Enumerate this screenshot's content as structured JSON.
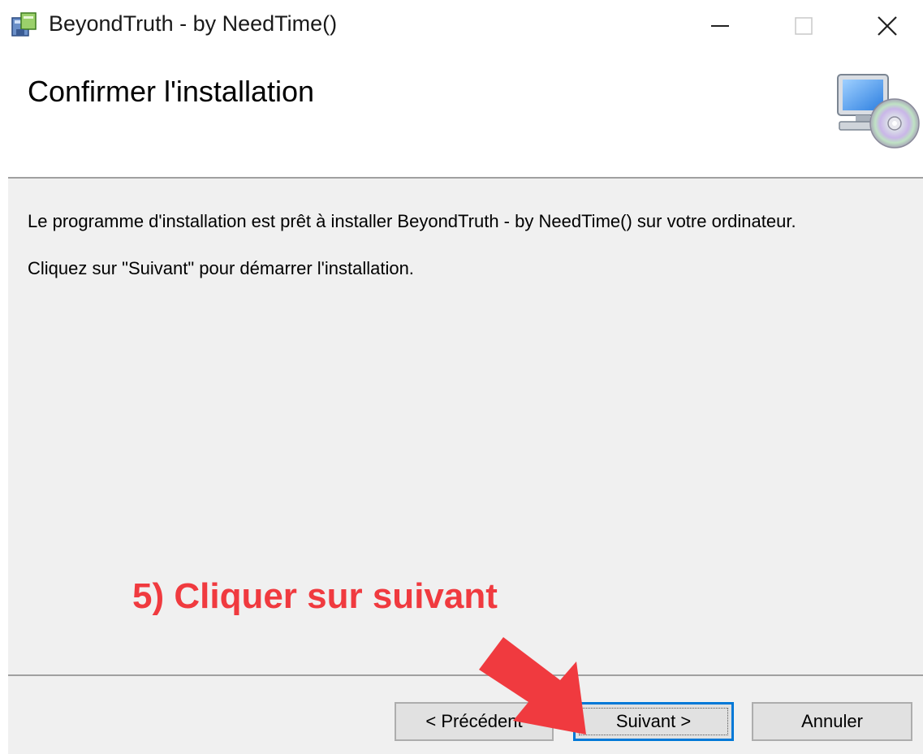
{
  "window": {
    "title": "BeyondTruth - by NeedTime()",
    "app_icon": "installer-icon",
    "controls": {
      "minimize": "minimize-icon",
      "maximize": "maximize-icon",
      "close": "close-icon"
    }
  },
  "header": {
    "title": "Confirmer l'installation",
    "icon": "computer-cd-icon"
  },
  "body": {
    "line1": "Le programme d'installation est prêt à installer BeyondTruth - by NeedTime() sur votre ordinateur.",
    "line2": "Cliquez sur \"Suivant\" pour démarrer l'installation."
  },
  "annotation": {
    "text": "5) Cliquer sur suivant",
    "color": "#f03a3f",
    "arrow_icon": "red-arrow-icon"
  },
  "buttons": {
    "previous": "< Précédent",
    "next": "Suivant >",
    "cancel": "Annuler"
  },
  "colors": {
    "focus_border": "#0078d7",
    "panel_bg": "#f0f0f0",
    "annotation": "#f03a3f"
  }
}
